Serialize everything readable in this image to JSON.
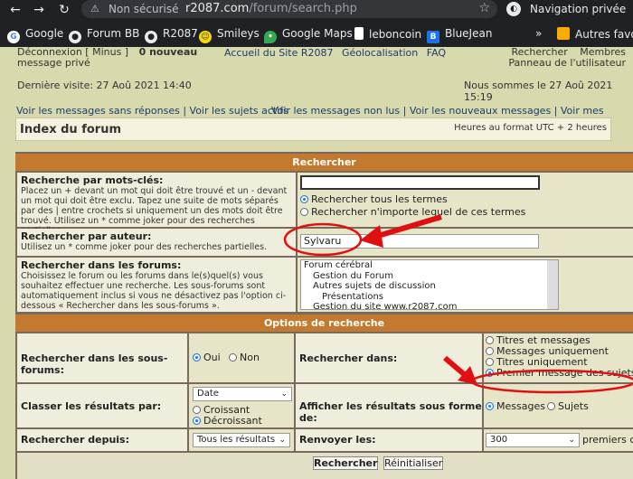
{
  "browser": {
    "back_icon": "arrow-left",
    "forward_icon": "arrow-right",
    "reload_icon": "reload",
    "insecure_label": "Non sécurisé",
    "url_host": "r2087.com",
    "url_path": "/forum/search.php",
    "incognito_label": "Navigation privée",
    "bookmarks": [
      {
        "label": "Google",
        "icon": "google-icon"
      },
      {
        "label": "Forum BB",
        "icon": "github-icon"
      },
      {
        "label": "R2087",
        "icon": "github-icon"
      },
      {
        "label": "Smileys",
        "icon": "smiley-icon"
      },
      {
        "label": "Google Maps",
        "icon": "maps-icon"
      },
      {
        "label": "leboncoin",
        "icon": "leboncoin-icon"
      },
      {
        "label": "BlueJean",
        "icon": "bluejean-icon"
      },
      {
        "label": "Autres favoris",
        "icon": "folder-icon"
      }
    ],
    "more_icon": "»"
  },
  "header": {
    "left_line1": "Déconnexion [ Minus ]",
    "left_count": "0 nouveau",
    "left_line2": "message privé",
    "nav_accueil": "Accueil du Site R2087",
    "nav_geoloc": "Géolocalisation",
    "nav_faq": "FAQ",
    "nav_rechercher": "Rechercher",
    "nav_membres": "Membres",
    "nav_panneau": "Panneau de l'utilisateur",
    "last_visit": "Dernière visite: 27 Aoû 2021 14:40",
    "today": "Nous sommes le 27 Aoû 2021 15:19"
  },
  "links": {
    "left": "Voir les messages sans réponses | Voir les sujets actifs",
    "right": "Voir les messages non lus | Voir les nouveaux messages | Voir mes messages"
  },
  "index": {
    "title": "Index du forum",
    "timezone": "Heures au format UTC + 2 heures"
  },
  "search": {
    "header": "Rechercher",
    "keywords_label": "Recherche par mots-clés:",
    "keywords_help": "Placez un + devant un mot qui doit être trouvé et un - devant un mot qui doit être exclu. Tapez une suite de mots séparés par des | entre crochets si uniquement un des mots doit être trouvé. Utilisez un * comme joker pour des recherches partielles.",
    "keywords_value": "",
    "opt_all_terms": "Rechercher tous les termes",
    "opt_any_terms": "Rechercher n'importe lequel de ces termes",
    "author_label": "Rechercher par auteur:",
    "author_help": "Utilisez un * comme joker pour des recherches partielles.",
    "author_value": "Sylvaru",
    "forums_label": "Rechercher dans les forums:",
    "forums_help": "Choisissez le forum ou les forums dans le(s)quel(s) vous souhaitez effectuer une recherche. Les sous-forums sont automatiquement inclus si vous ne désactivez pas l'option ci-dessous « Rechercher dans les sous-forums ».",
    "forums_list": [
      "Forum cérébral",
      "Gestion du Forum",
      "Autres sujets de discussion",
      "Présentations",
      "Gestion du site www.r2087.com"
    ]
  },
  "options": {
    "header": "Options de recherche",
    "subforums_label": "Rechercher dans les sous-forums:",
    "yes": "Oui",
    "no": "Non",
    "search_in_label": "Rechercher dans:",
    "search_in_options": [
      "Titres et messages",
      "Messages uniquement",
      "Titres uniquement",
      "Premier message des sujets u"
    ],
    "sort_label": "Classer les résultats par:",
    "sort_value": "Date",
    "asc": "Croissant",
    "desc": "Décroissant",
    "display_label": "Afficher les résultats sous forme de:",
    "display_messages": "Messages",
    "display_topics": "Sujets",
    "since_label": "Rechercher depuis:",
    "since_value": "Tous les résultats",
    "return_label": "Renvoyer les:",
    "return_value": "300",
    "return_suffix": "premiers ca"
  },
  "buttons": {
    "search": "Rechercher",
    "reset": "Réinitialiser"
  },
  "annotation_color": "#e01010"
}
